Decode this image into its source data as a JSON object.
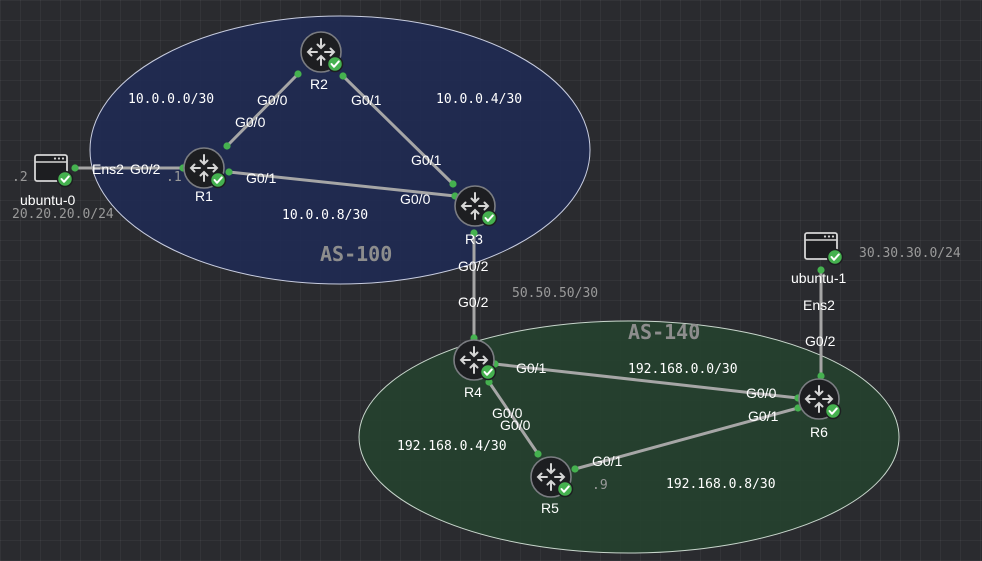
{
  "areas": {
    "as100": "AS-100",
    "as140": "AS-140"
  },
  "nodes": {
    "r1": "R1",
    "r2": "R2",
    "r3": "R3",
    "r4": "R4",
    "r5": "R5",
    "r6": "R6",
    "ubuntu0": "ubuntu-0",
    "ubuntu1": "ubuntu-1"
  },
  "interfaces": {
    "r1_r2_r2side": "G0/0",
    "r1_r2_r1side": "G0/0",
    "r2_r3_r2side": "G0/1",
    "r2_r3_r3side": "G0/1",
    "r1_r3_r1side": "G0/1",
    "r1_r3_r3side": "G0/0",
    "ubuntu0_r1_hostside": "Ens2",
    "ubuntu0_r1_r1side": "G0/2",
    "r3_r4_r3side": "G0/2",
    "r3_r4_r4side": "G0/2",
    "r4_r6_r4side": "G0/1",
    "r4_r6_r6side": "G0/0",
    "r4_r5_r4side": "G0/0",
    "r4_r5_r5side": "G0/0",
    "r5_r6_r5side": "G0/1",
    "r5_r6_r6side": "G0/1",
    "ubuntu1_r6_hostside": "Ens2",
    "ubuntu1_r6_r6side": "G0/2"
  },
  "subnets": {
    "r1_r2": "10.0.0.0/30",
    "r2_r3": "10.0.0.4/30",
    "r1_r3": "10.0.0.8/30",
    "ubuntu0_lan": "20.20.20.0/24",
    "r3_r4": "50.50.50/30",
    "ubuntu1_lan": "30.30.30.0/24",
    "r4_r6": "192.168.0.0/30",
    "r4_r5": "192.168.0.4/30",
    "r5_r6": "192.168.0.8/30"
  },
  "host_ips": {
    "ubuntu0": ".2",
    "r1_lan": ".1",
    "r5_link": ".9"
  },
  "colors": {
    "as100_fill": "#1f2a52",
    "as140_fill": "#25412f",
    "link": "#a6a6a6",
    "port": "#45b14f",
    "status": "#45b14f"
  },
  "icons": {
    "router": "router-icon",
    "host": "server-icon",
    "status": "check-icon"
  }
}
